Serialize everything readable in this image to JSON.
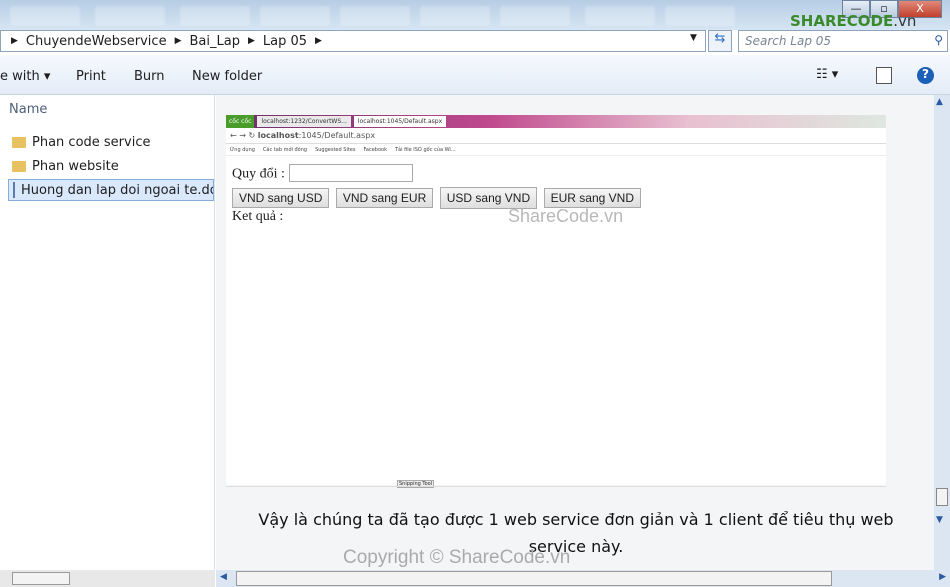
{
  "window": {
    "minimize": "—",
    "maximize": "▫",
    "close": "X"
  },
  "watermark": {
    "logo": "SHARECODE",
    "logo_suffix": ".vn",
    "mid": "ShareCode.vn",
    "bottom": "Copyright © ShareCode.vn"
  },
  "breadcrumb": [
    "ChuyendeWebservice",
    "Bai_Lap",
    "Lap 05"
  ],
  "search": {
    "placeholder": "Search Lap 05"
  },
  "toolbar": {
    "share_with": "e with ▾",
    "print": "Print",
    "burn": "Burn",
    "new_folder": "New folder"
  },
  "nav": {
    "header": "Name",
    "items": [
      {
        "label": "Phan code service",
        "type": "folder"
      },
      {
        "label": "Phan website",
        "type": "folder"
      },
      {
        "label": "Huong dan lap doi ngoai te.do",
        "type": "document"
      }
    ]
  },
  "browser": {
    "brand": "cốc cốc",
    "tabs": [
      "localhost:1232/ConvertWS...",
      "localhost:1045/Default.aspx"
    ],
    "url_host": "localhost",
    "url_rest": ":1045/Default.aspx",
    "bookmarks": [
      "Ứng dụng",
      "Các tab mới đóng",
      "Suggested Sites",
      "Facebook",
      "Tải file ISO gốc của Wi..."
    ],
    "page": {
      "label": "Quy đổi :",
      "input_value": "",
      "buttons": [
        "VND sang USD",
        "VND sang EUR",
        "USD sang VND",
        "EUR sang VND"
      ],
      "result_label": "Ket quả :"
    }
  },
  "snipping_tool": "Snipping Tool",
  "caption": "Vậy là chúng ta đã tạo được 1 web service đơn giản và 1 client để tiêu thụ web service này."
}
